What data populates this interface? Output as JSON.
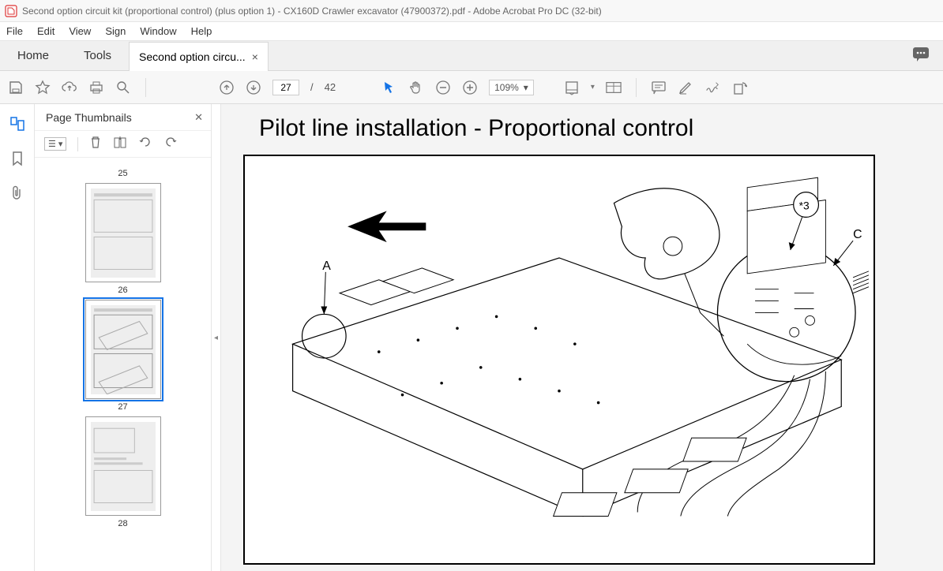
{
  "window": {
    "title": "Second option circuit kit (proportional control) (plus option 1) - CX160D Crawler excavator (47900372).pdf - Adobe Acrobat Pro DC (32-bit)"
  },
  "menu": {
    "items": [
      "File",
      "Edit",
      "View",
      "Sign",
      "Window",
      "Help"
    ]
  },
  "tabs": {
    "home": "Home",
    "tools": "Tools",
    "doc": "Second option circu...",
    "close_glyph": "×"
  },
  "toolbar": {
    "page_current": "27",
    "page_total": "42",
    "page_sep": "/",
    "zoom": "109%"
  },
  "sidebar": {
    "title": "Page Thumbnails",
    "close_glyph": "✕",
    "thumbs": [
      {
        "num": "25"
      },
      {
        "num": "26"
      },
      {
        "num": "27",
        "selected": true
      },
      {
        "num": "28"
      }
    ]
  },
  "document": {
    "heading": "Pilot line installation - Proportional control",
    "callouts": {
      "a": "A",
      "c": "C",
      "star3": "*3"
    }
  }
}
